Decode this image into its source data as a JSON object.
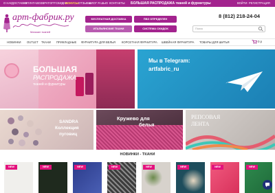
{
  "colors": {
    "brand": "#a3238e",
    "accent_pink": "#e3127d",
    "badge": "#e3127d"
  },
  "topbar": {
    "items": [
      "О НАС",
      "ДОСТАВКА",
      "ОПЛАТА",
      "ВОЗВРАТ",
      "ОПТ",
      "СКИДКИ",
      "БОНУСЫ",
      "ОТЗЫВЫ",
      "БЛОГ",
      "Я ШЬЮ",
      "КОНТАКТЫ"
    ],
    "promo": "БОЛЬШАЯ РАСПРОДАЖА тканей и фурнитуры",
    "login": "ВОЙТИ",
    "register": "РЕГИСТРАЦИЯ"
  },
  "logo": {
    "name": "арт-фабрик.ру",
    "tagline": "Магазин тканей",
    "icon": "mannequin-icon"
  },
  "shortcuts": [
    {
      "label": "БЕСПЛАТНАЯ ДОСТАВКА",
      "color": "#a3238e"
    },
    {
      "label": "ПВЗ ОПРЕДЕЛЕН",
      "color": "#a3238e"
    },
    {
      "label": "ИТАЛЬЯНСКИЕ ТКАНИ",
      "color": "#b85bb0"
    },
    {
      "label": "СИСТЕМА СКИДОК",
      "color": "#a3238e"
    }
  ],
  "phone": "8 (812) 218-24-04",
  "search": {
    "placeholder": "Поиск",
    "icon": "search-icon"
  },
  "nav": {
    "items": [
      "НОВИНКИ",
      "OUTLET",
      "ТКАНИ",
      "ПРИКЛАДНЫЕ",
      "ФУРНИТУРА ДЛЯ ВЕЛЬЯ",
      "КОРСЕТНАЯ ФУРНИТУРА",
      "ШВЕЙНАЯ ФУРНИТУРА",
      "ТОВАРЫ ДЛЯ ШИТЬЯ"
    ]
  },
  "cart": {
    "icon": "cart-icon",
    "count": "0",
    "label": "0 р"
  },
  "banners": {
    "sale": {
      "line1": "БОЛЬШАЯ",
      "line2": "РАСПРОДАЖА",
      "line3": "тканей и фурнитуры"
    },
    "telegram": {
      "line1": "Мы в Telegram:",
      "line2": "artfabric_ru",
      "icon": "paper-plane-icon"
    },
    "sandra": {
      "line1": "SANDRA",
      "line2": "Коллекция",
      "line3": "пуговиц"
    },
    "lace": {
      "line1": "Кружево для",
      "line2": "белья"
    },
    "ribbon": {
      "line1": "РЕПСОВАЯ",
      "line2": "ЛЕНТА"
    }
  },
  "section": {
    "title": "НОВИНКИ - ТКАНИ"
  },
  "products": [
    {
      "badge": "NEW",
      "color": "#f0efec"
    },
    {
      "badge": "NEW",
      "color": "#1f2a1e"
    },
    {
      "badge": "NEW",
      "color": "#2b3b8a"
    },
    {
      "badge": "NEW",
      "color": "#3c3c3c"
    },
    {
      "badge": "NEW",
      "color": "#d7d2cc"
    },
    {
      "badge": "NEW",
      "color": "#1e4d5c"
    },
    {
      "badge": "NEW",
      "color": "#d8315b"
    },
    {
      "badge": "NEW",
      "color": "#1f6b3a"
    }
  ]
}
